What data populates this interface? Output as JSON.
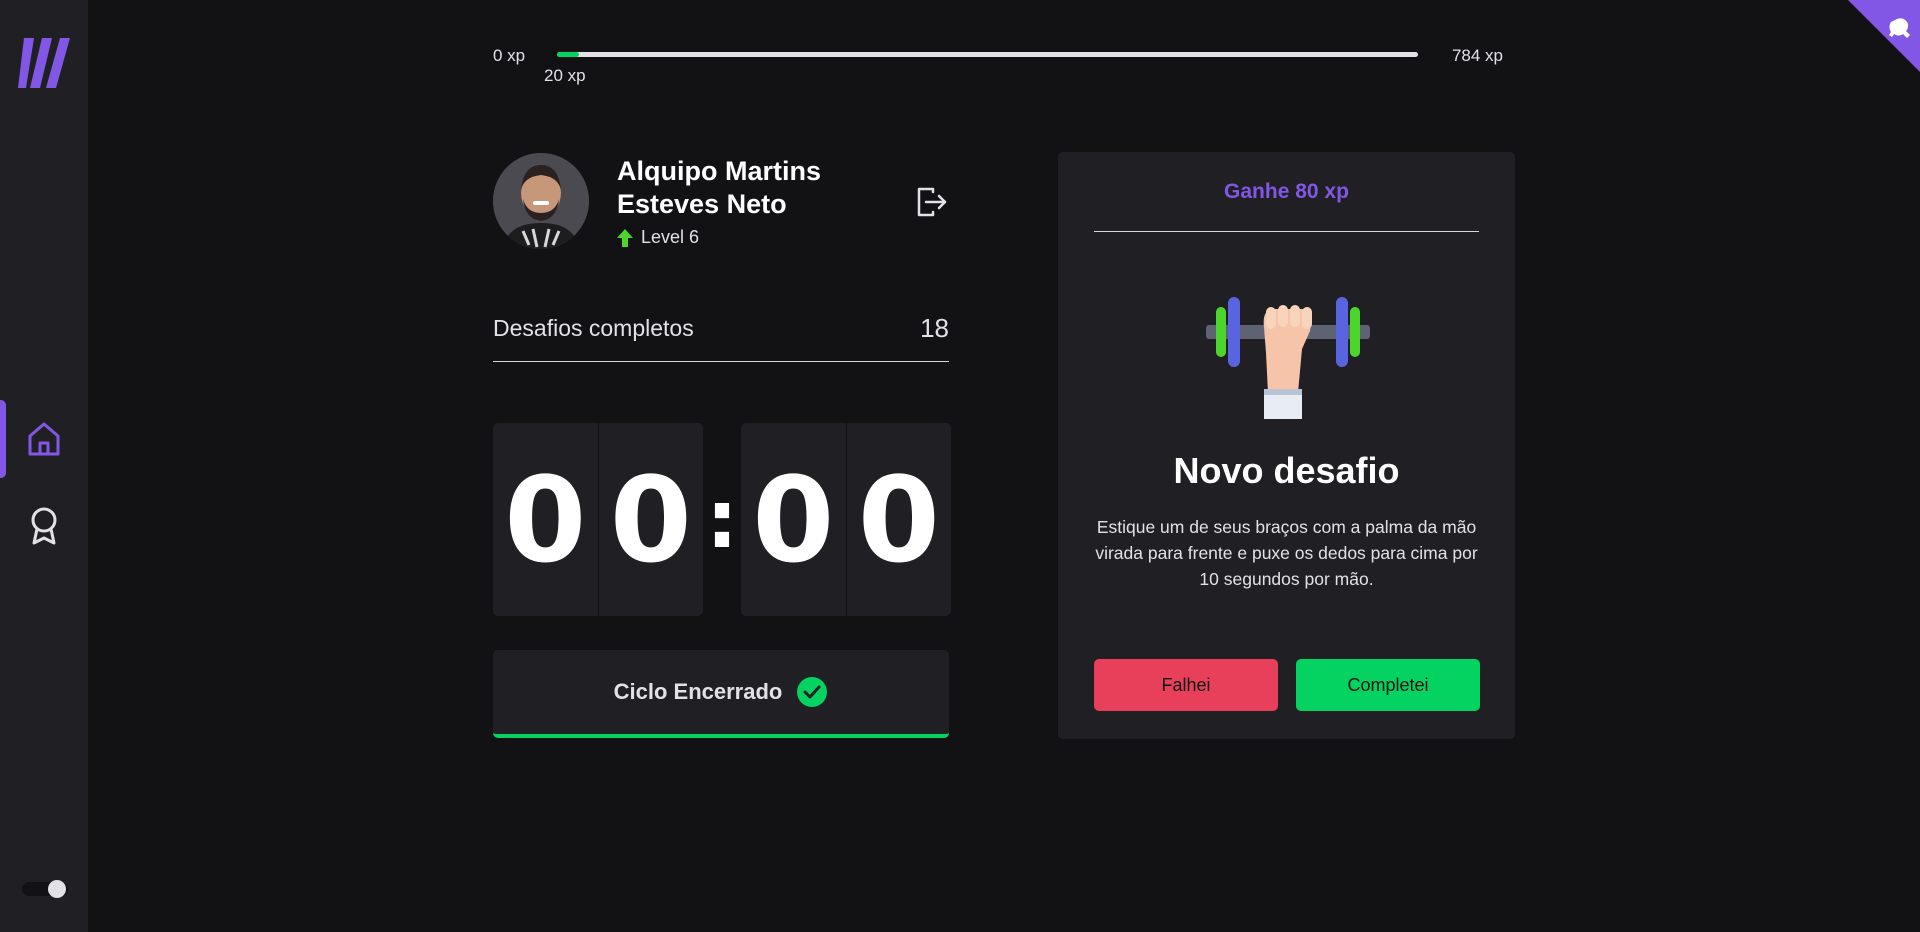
{
  "colors": {
    "background": "#121214",
    "panel": "#202024",
    "accent": "#8257e5",
    "success": "#04d361",
    "danger": "#e83f5b",
    "text": "#e1e1e6"
  },
  "sidebar": {
    "items": [
      {
        "icon": "home-icon",
        "active": true
      },
      {
        "icon": "award-icon",
        "active": false
      }
    ],
    "theme_toggle": {
      "state": "on"
    }
  },
  "xp": {
    "min_label": "0 xp",
    "max_label": "784 xp",
    "current_label": "20 xp",
    "progress_percent": 2.55
  },
  "profile": {
    "name": "Alquipo Martins Esteves Neto",
    "level": "Level 6"
  },
  "stats": {
    "completed_label": "Desafios completos",
    "completed_value": "18"
  },
  "countdown": {
    "minute_tens": "0",
    "minute_ones": "0",
    "separator": ":",
    "second_tens": "0",
    "second_ones": "0"
  },
  "cycle_button": {
    "label": "Ciclo Encerrado"
  },
  "challenge": {
    "reward": "Ganhe 80 xp",
    "title": "Novo desafio",
    "description": "Estique um de seus braços com a palma da mão virada para frente e puxe os dedos para cima por 10 segundos por mão.",
    "fail_label": "Falhei",
    "success_label": "Completei"
  }
}
